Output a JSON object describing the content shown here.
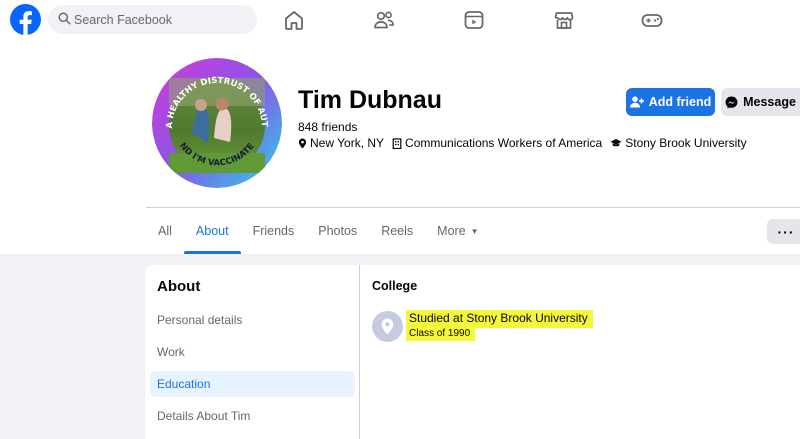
{
  "search": {
    "placeholder": "Search Facebook"
  },
  "nav": {
    "icons": [
      "home-icon",
      "friends-icon",
      "watch-icon",
      "marketplace-icon",
      "gaming-icon"
    ]
  },
  "profile": {
    "name": "Tim Dubnau",
    "friends": "848 friends",
    "location": "New York, NY",
    "workplace": "Communications Workers of America",
    "school": "Stony Brook University",
    "avatar_ring_text_top": "I HAVE A HEALTHY DISTRUST OF AUTHORITY",
    "avatar_ring_text_bottom": "AND I'M VACCINATED"
  },
  "buttons": {
    "add_friend": "Add friend",
    "message": "Message"
  },
  "tabs": [
    {
      "label": "All",
      "active": false
    },
    {
      "label": "About",
      "active": true
    },
    {
      "label": "Friends",
      "active": false
    },
    {
      "label": "Photos",
      "active": false
    },
    {
      "label": "Reels",
      "active": false
    },
    {
      "label": "More",
      "active": false
    }
  ],
  "more_menu": "···",
  "about": {
    "title": "About",
    "items": [
      "Personal details",
      "Work",
      "Education",
      "Details About Tim"
    ],
    "active_item": "Education",
    "section_title": "College",
    "entry": {
      "title": "Studied at Stony Brook University",
      "subtitle": "Class of 1990"
    }
  },
  "colors": {
    "accent": "#1b74e4",
    "highlight": "#f5f83a",
    "background": "#f0f2f5"
  }
}
